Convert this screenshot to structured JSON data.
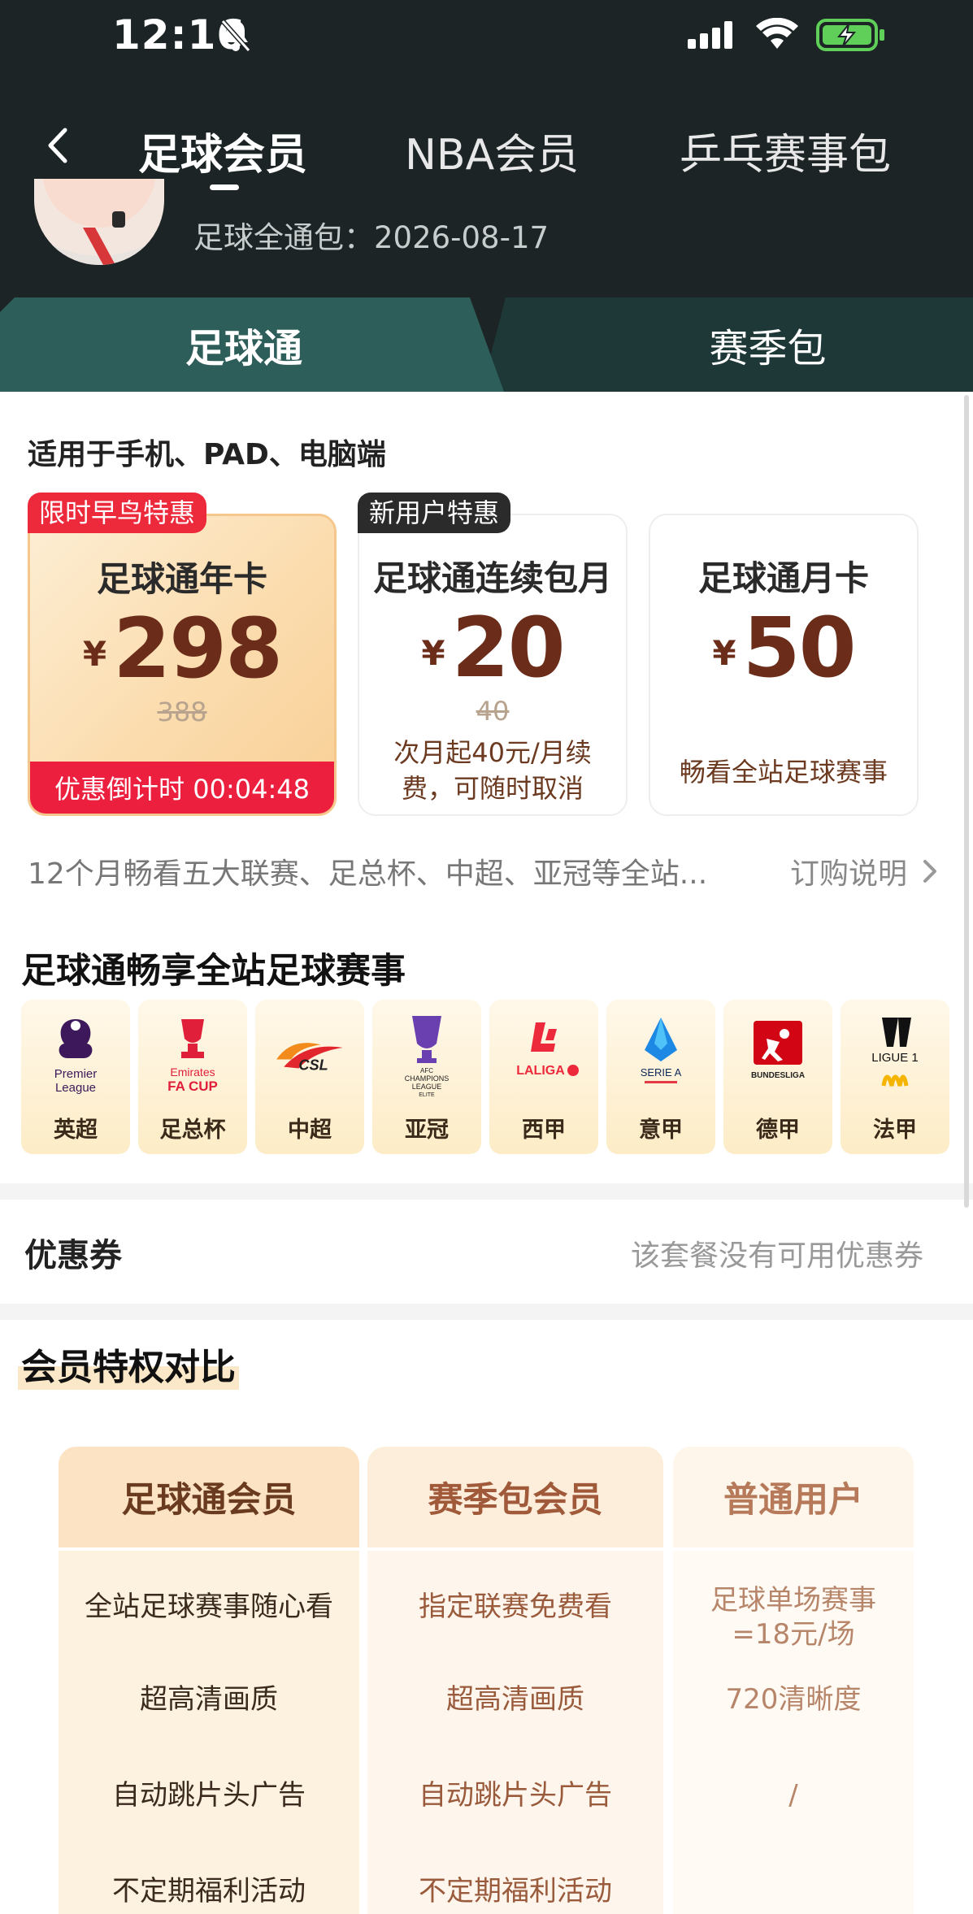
{
  "status_bar": {
    "time": "12:16"
  },
  "nav": {
    "tabs": [
      {
        "label": "足球会员",
        "active": true
      },
      {
        "label": "NBA会员",
        "active": false
      },
      {
        "label": "乒乓赛事包",
        "active": false
      }
    ]
  },
  "member": {
    "expiry": "足球全通包：2026-08-17"
  },
  "package_tabs": [
    {
      "label": "足球通",
      "active": true
    },
    {
      "label": "赛季包",
      "active": false
    }
  ],
  "devices_note": "适用于手机、PAD、电脑端",
  "plans": [
    {
      "badge": "限时早鸟特惠",
      "name": "足球通年卡",
      "currency": "¥",
      "price": "298",
      "original_price": "388",
      "countdown": "优惠倒计时 00:04:48",
      "selected": true
    },
    {
      "badge": "新用户特惠",
      "name": "足球通连续包月",
      "currency": "¥",
      "price": "20",
      "original_price": "40",
      "desc": "次月起40元/月续费，可随时取消"
    },
    {
      "name": "足球通月卡",
      "currency": "¥",
      "price": "50",
      "desc": "畅看全站足球赛事"
    }
  ],
  "plan_summary": "12个月畅看五大联赛、足总杯、中超、亚冠等全站...",
  "purchase_note": "订购说明",
  "leagues_title": "足球通畅享全站足球赛事",
  "leagues": [
    {
      "name": "英超",
      "logo_text": "Premier League",
      "icon": "premier-league-logo"
    },
    {
      "name": "足总杯",
      "logo_text": "Emirates FA CUP",
      "icon": "fa-cup-logo"
    },
    {
      "name": "中超",
      "logo_text": "CSL",
      "icon": "csl-logo"
    },
    {
      "name": "亚冠",
      "logo_text": "AFC CHAMPIONS LEAGUE ELITE",
      "icon": "afc-champions-league-logo"
    },
    {
      "name": "西甲",
      "logo_text": "LALIGA",
      "icon": "laliga-logo"
    },
    {
      "name": "意甲",
      "logo_text": "SERIE A",
      "icon": "serie-a-logo"
    },
    {
      "name": "德甲",
      "logo_text": "BUNDESLIGA",
      "icon": "bundesliga-logo"
    },
    {
      "name": "法甲",
      "logo_text": "LIGUE 1",
      "icon": "ligue-1-logo"
    }
  ],
  "coupon": {
    "label": "优惠券",
    "value": "该套餐没有可用优惠券"
  },
  "comparison": {
    "title": "会员特权对比",
    "columns": [
      {
        "header": "足球通会员",
        "rows": [
          "全站足球赛事随心看",
          "超高清画质",
          "自动跳片头广告",
          "不定期福利活动"
        ]
      },
      {
        "header": "赛季包会员",
        "rows": [
          "指定联赛免费看",
          "超高清画质",
          "自动跳片头广告",
          "不定期福利活动"
        ]
      },
      {
        "header": "普通用户",
        "rows": [
          "足球单场赛事=18元/场",
          "720清晰度",
          "/",
          ""
        ]
      }
    ]
  },
  "colors": {
    "header_bg": "#1c2425",
    "active_tab": "#2d5e5a",
    "price_brown": "#6b2d1a",
    "countdown_red": "#ec1f3f"
  }
}
